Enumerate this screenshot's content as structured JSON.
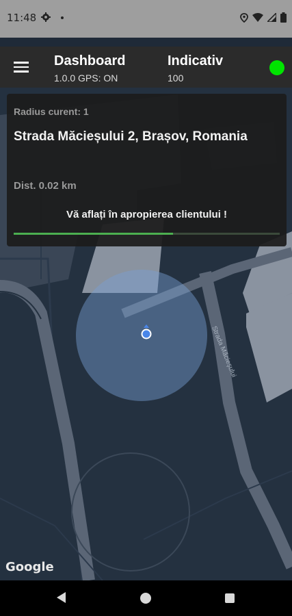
{
  "status_bar": {
    "time": "11:48",
    "icons": [
      "gear-icon",
      "notification-dot-icon",
      "location-icon",
      "wifi-icon",
      "signal-icon",
      "battery-icon"
    ]
  },
  "app_bar": {
    "title": "Dashboard",
    "subtitle": "1.0.0 GPS: ON",
    "indicativ_label": "Indicativ",
    "indicativ_value": "100",
    "status_color": "#00e400"
  },
  "info_card": {
    "radius_text": "Radius curent: 1",
    "address": "Strada Măcieșului 2, Brașov, Romania",
    "distance_text": "Dist. 0.02 km",
    "message": "Vă aflați în apropierea clientului !",
    "progress_fraction": 0.6
  },
  "map": {
    "street_label": "Strada Măcieșului",
    "attribution": "Google",
    "accent_color": "#4a86e8"
  },
  "nav_bar": {
    "icons": [
      "back-icon",
      "home-icon",
      "recents-icon"
    ]
  }
}
